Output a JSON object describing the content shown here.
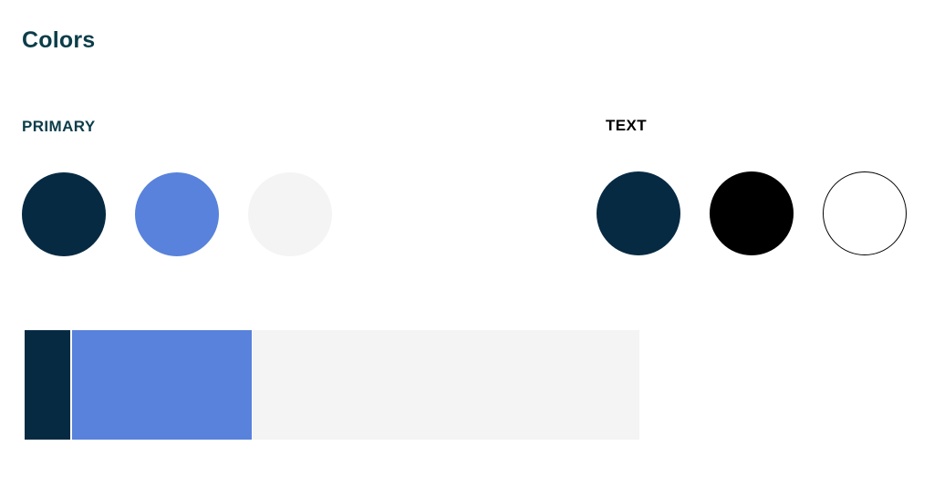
{
  "title": "Colors",
  "sections": {
    "primary": {
      "label": "PRIMARY",
      "swatches": [
        {
          "name": "dark-navy",
          "color": "#072a43"
        },
        {
          "name": "cornflower-blue",
          "color": "#5882db"
        },
        {
          "name": "light-gray",
          "color": "#f4f4f4"
        }
      ]
    },
    "text": {
      "label": "TEXT",
      "swatches": [
        {
          "name": "dark-navy",
          "color": "#072a43"
        },
        {
          "name": "black",
          "color": "#000000"
        },
        {
          "name": "white",
          "color": "#ffffff"
        }
      ]
    }
  },
  "palette_bar": {
    "segments": [
      {
        "color": "#072a43"
      },
      {
        "color": "#5882db"
      },
      {
        "color": "#f4f4f4"
      }
    ]
  },
  "colors": {
    "heading": "#0b3d49",
    "text_label": "#000000",
    "outline": "#000000"
  }
}
